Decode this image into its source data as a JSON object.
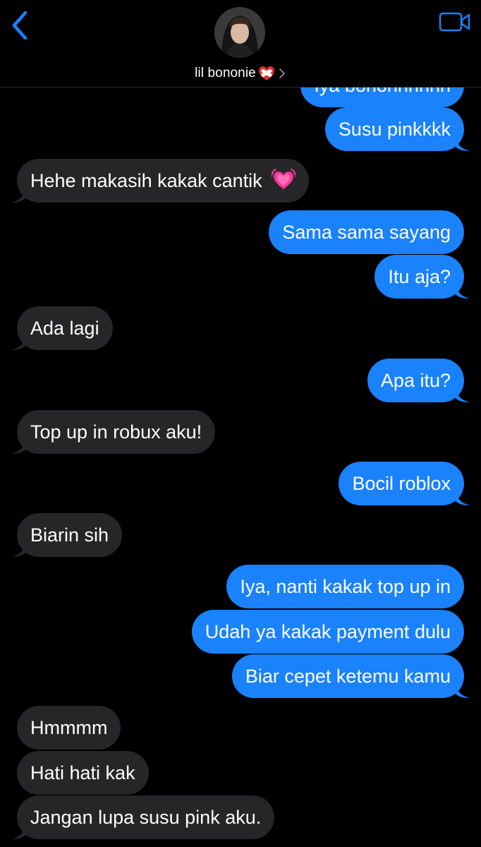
{
  "header": {
    "contact_name": "lil bononie",
    "back_icon": "chevron-left-icon",
    "video_icon": "video-camera-icon",
    "accent_color": "#1a82fb"
  },
  "messages": [
    {
      "direction": "sent",
      "text": "Iya bononnnnnn"
    },
    {
      "direction": "sent",
      "text": "Susu pinkkkk"
    },
    {
      "direction": "recv",
      "text": "Hehe makasih kakak cantik",
      "emoji": "growing-heart"
    },
    {
      "direction": "sent",
      "text": "Sama sama sayang"
    },
    {
      "direction": "sent",
      "text": "Itu aja?"
    },
    {
      "direction": "recv",
      "text": "Ada lagi"
    },
    {
      "direction": "sent",
      "text": "Apa itu?"
    },
    {
      "direction": "recv",
      "text": "Top up in robux aku!"
    },
    {
      "direction": "sent",
      "text": "Bocil roblox"
    },
    {
      "direction": "recv",
      "text": "Biarin sih"
    },
    {
      "direction": "sent",
      "text": "Iya, nanti kakak top up in"
    },
    {
      "direction": "sent",
      "text": "Udah ya kakak payment dulu"
    },
    {
      "direction": "sent",
      "text": "Biar cepet ketemu kamu"
    },
    {
      "direction": "recv",
      "text": "Hmmmm"
    },
    {
      "direction": "recv",
      "text": "Hati hati kak"
    },
    {
      "direction": "recv",
      "text": "Jangan lupa susu pink aku."
    }
  ],
  "colors": {
    "sent_bubble": "#1a82fb",
    "received_bubble": "#262628",
    "background": "#000000",
    "text": "#ffffff"
  }
}
